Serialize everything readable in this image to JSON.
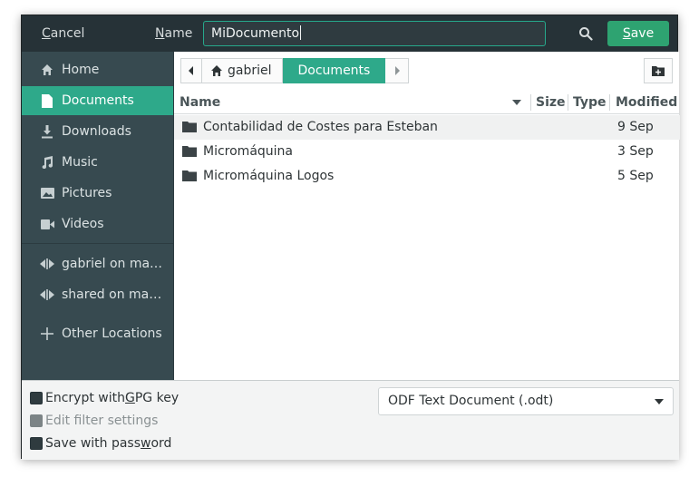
{
  "header": {
    "cancel_pre": "",
    "cancel_mn": "C",
    "cancel_post": "ancel",
    "name_mn": "N",
    "name_post": "ame",
    "name_value": "MiDocumento",
    "save_mn": "S",
    "save_post": "ave"
  },
  "sidebar": {
    "items": [
      {
        "label": "Home",
        "icon": "home-icon"
      },
      {
        "label": "Documents",
        "icon": "document-icon"
      },
      {
        "label": "Downloads",
        "icon": "download-icon"
      },
      {
        "label": "Music",
        "icon": "music-icon"
      },
      {
        "label": "Pictures",
        "icon": "pictures-icon"
      },
      {
        "label": "Videos",
        "icon": "videos-icon"
      },
      {
        "label": "gabriel on ma…",
        "icon": "network-icon"
      },
      {
        "label": "shared on ma…",
        "icon": "network-icon"
      },
      {
        "label": "Other Locations",
        "icon": "plus-icon"
      }
    ]
  },
  "pathbar": {
    "home": "gabriel",
    "current": "Documents"
  },
  "columns": {
    "name": "Name",
    "size": "Size",
    "type": "Type",
    "modified": "Modified"
  },
  "files": [
    {
      "name": "Contabilidad de Costes para Esteban",
      "modified": "9 Sep"
    },
    {
      "name": "Micromáquina",
      "modified": "3 Sep"
    },
    {
      "name": "Micromáquina Logos",
      "modified": "5 Sep"
    }
  ],
  "footer": {
    "encrypt_pre": "Encrypt with ",
    "encrypt_mn": "G",
    "encrypt_post": "PG key",
    "filter": "Edit filter settings",
    "password_pre": "Save with pass",
    "password_mn": "w",
    "password_post": "ord",
    "file_type": "ODF Text Document (.odt)"
  },
  "colors": {
    "accent": "#2ea98a",
    "save": "#2ea371",
    "header_bg": "#263237",
    "sidebar_bg": "#374a50"
  }
}
